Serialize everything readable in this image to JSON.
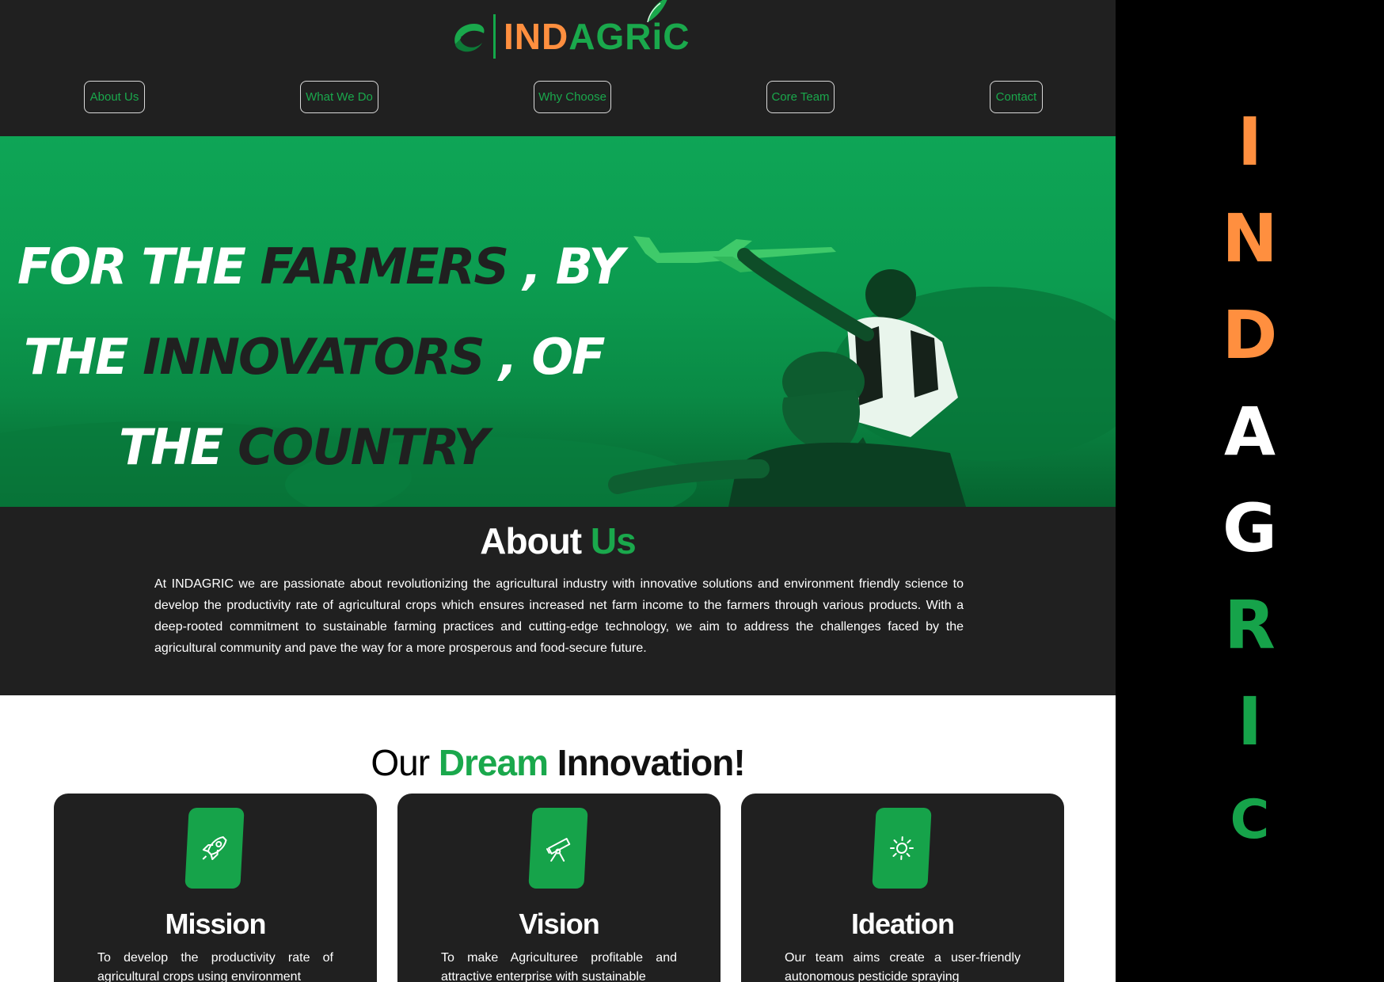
{
  "brand": {
    "ind": "IND",
    "agric": "AGRiC",
    "orange": "#ff8f3f",
    "green": "#1aa84c"
  },
  "nav": {
    "items": [
      {
        "label": "About Us"
      },
      {
        "label": "What We Do"
      },
      {
        "label": "Why Choose"
      },
      {
        "label": "Core Team"
      },
      {
        "label": "Contact"
      }
    ]
  },
  "hero": {
    "line1_a": "FOR THE ",
    "line1_b": "FARMERS",
    "line1_c": " , BY",
    "line2_a": "THE ",
    "line2_b": "INNOVATORS",
    "line2_c": " , OF",
    "line3_a": "THE ",
    "line3_b": "COUNTRY"
  },
  "about": {
    "title_a": "About ",
    "title_b": "Us",
    "text": "At INDAGRIC we are passionate about revolutionizing the agricultural industry with innovative solutions and environment friendly science to develop the productivity rate of agricultural crops which ensures increased net farm income to the farmers through various products. With a deep-rooted commitment to sustainable farming practices and cutting-edge technology, we aim to address the challenges faced by the agricultural community and pave the way for a more prosperous and food-secure future."
  },
  "dream": {
    "title_a": "Our ",
    "title_b": "Dream",
    "title_c": " Innovation!",
    "cards": [
      {
        "icon": "rocket-icon",
        "title": "Mission",
        "text": "To develop the productivity rate of agricultural crops using environment"
      },
      {
        "icon": "telescope-icon",
        "title": "Vision",
        "text": "To make Agriculturee profitable and attractive enterprise with sustainable"
      },
      {
        "icon": "sun-icon",
        "title": "Ideation",
        "text": "Our team aims create a user-friendly autonomous pesticide spraying"
      }
    ]
  },
  "side": {
    "letters": [
      {
        "char": "I",
        "color": "#ff8f3f"
      },
      {
        "char": "N",
        "color": "#ff8f3f"
      },
      {
        "char": "D",
        "color": "#ff8f3f"
      },
      {
        "char": "A",
        "color": "#ffffff"
      },
      {
        "char": "G",
        "color": "#ffffff"
      },
      {
        "char": "R",
        "color": "#16a34a"
      },
      {
        "char": "I",
        "color": "#16a34a"
      },
      {
        "char": "C",
        "color": "#16a34a"
      }
    ]
  }
}
